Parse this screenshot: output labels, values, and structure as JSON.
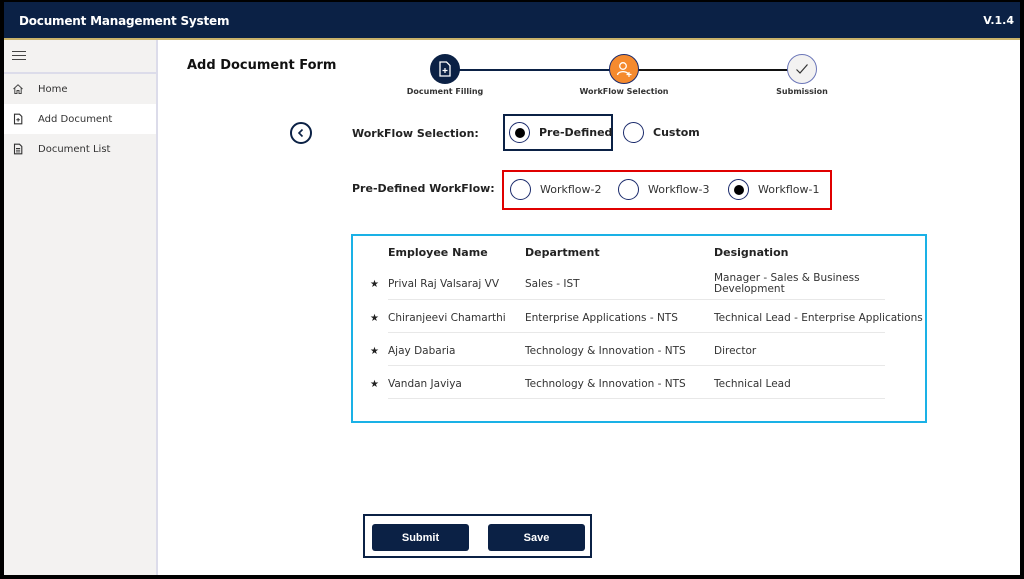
{
  "app": {
    "title": "Document Management System",
    "version": "V.1.4"
  },
  "sidebar": {
    "items": [
      {
        "label": "Home",
        "icon": "home-icon",
        "active": false
      },
      {
        "label": "Add Document",
        "icon": "add-document-icon",
        "active": true
      },
      {
        "label": "Document List",
        "icon": "document-list-icon",
        "active": false
      }
    ]
  },
  "form": {
    "title": "Add Document Form",
    "steps": [
      {
        "label": "Document Filling",
        "icon": "document-plus-icon",
        "status": "completed",
        "color": "#0b2145"
      },
      {
        "label": "WorkFlow Selection",
        "icon": "user-plus-icon",
        "status": "current",
        "color": "#f58a2e"
      },
      {
        "label": "Submission",
        "icon": "check-icon",
        "status": "pending",
        "color": "#f3f2f1"
      }
    ],
    "workflow_selection": {
      "label": "WorkFlow Selection:",
      "options": [
        {
          "label": "Pre-Defined",
          "selected": true
        },
        {
          "label": "Custom",
          "selected": false
        }
      ]
    },
    "predefined_workflow": {
      "label": "Pre-Defined WorkFlow:",
      "options": [
        {
          "label": "Workflow-2",
          "selected": false
        },
        {
          "label": "Workflow-3",
          "selected": false
        },
        {
          "label": "Workflow-1",
          "selected": true
        }
      ]
    },
    "table": {
      "columns": [
        "Employee Name",
        "Department",
        "Designation"
      ],
      "rows": [
        {
          "name": "Prival Raj Valsaraj VV",
          "department": "Sales - IST",
          "designation": "Manager - Sales & Business Development"
        },
        {
          "name": "Chiranjeevi Chamarthi",
          "department": "Enterprise Applications - NTS",
          "designation": "Technical Lead - Enterprise Applications"
        },
        {
          "name": "Ajay Dabaria",
          "department": "Technology & Innovation - NTS",
          "designation": "Director"
        },
        {
          "name": "Vandan Javiya",
          "department": "Technology & Innovation - NTS",
          "designation": "Technical Lead"
        }
      ],
      "bullet": "★"
    },
    "buttons": {
      "submit": "Submit",
      "save": "Save"
    }
  },
  "colors": {
    "navy": "#0b2145",
    "orange": "#f58a2e",
    "highlight_red": "#e00000",
    "table_border": "#1ab1e6"
  }
}
